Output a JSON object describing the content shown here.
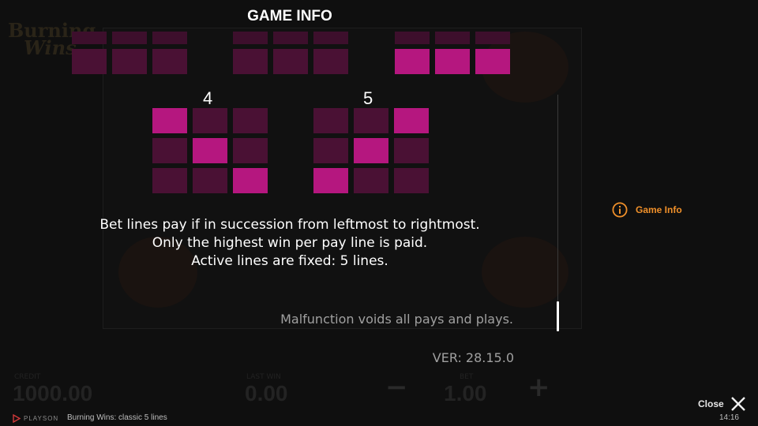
{
  "header": {
    "title": "GAME INFO"
  },
  "background": {
    "logo_line1": "Burning",
    "logo_line2": "Wins",
    "credit_label": "CREDIT",
    "credit_value": "1000.00",
    "win_label": "LAST WIN",
    "win_value": "0.00",
    "bet_label": "BET",
    "bet_value": "1.00",
    "minus_icon": "minus-icon",
    "plus_icon": "plus-icon"
  },
  "paylines": {
    "top_partial": [
      {
        "pattern": [
          [
            1,
            1,
            1
          ],
          [
            0,
            0,
            0
          ],
          [
            0,
            0,
            0
          ]
        ],
        "visible_row": 2
      },
      {
        "pattern": [
          [
            1,
            1,
            1
          ],
          [
            0,
            0,
            0
          ],
          [
            0,
            0,
            0
          ]
        ],
        "visible_row": 2
      },
      {
        "pattern": [
          [
            0,
            0,
            0
          ],
          [
            0,
            0,
            0
          ],
          [
            1,
            1,
            1
          ]
        ],
        "visible_row": 2
      }
    ],
    "lines": [
      {
        "label": "4",
        "pattern": [
          [
            1,
            0,
            0
          ],
          [
            0,
            1,
            0
          ],
          [
            0,
            0,
            1
          ]
        ]
      },
      {
        "label": "5",
        "pattern": [
          [
            0,
            0,
            1
          ],
          [
            0,
            1,
            0
          ],
          [
            1,
            0,
            0
          ]
        ]
      }
    ]
  },
  "rules": {
    "line1": "Bet lines pay if in succession from leftmost to rightmost.",
    "line2": "Only the highest win per pay line is paid.",
    "line3": "Active lines are fixed: 5 lines."
  },
  "malfunction": "Malfunction voids all pays and plays.",
  "version": "VER: 28.15.0",
  "nav": {
    "game_info_label": "Game Info",
    "icon": "info-icon"
  },
  "footer": {
    "brand": "PLAYSON",
    "game_name": "Burning Wins: classic 5 lines",
    "time": "14:16"
  },
  "close": {
    "label": "Close",
    "icon": "close-icon"
  },
  "colors": {
    "cell_on": "#b5177f",
    "cell_off": "#4a1134",
    "accent": "#f0902a"
  }
}
